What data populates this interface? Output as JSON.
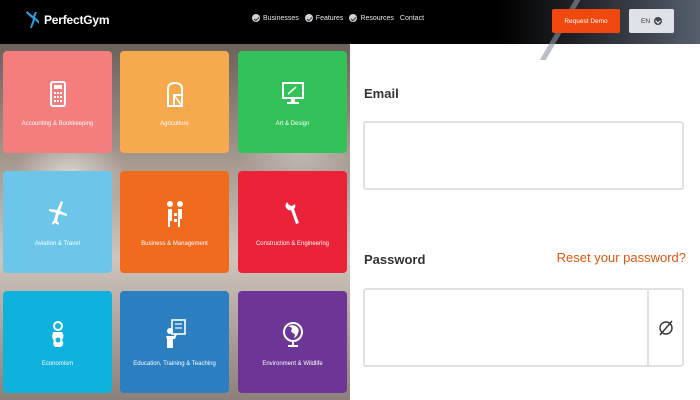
{
  "header": {
    "brand": "PerfectGym",
    "nav": [
      {
        "label": "Businesses",
        "icon": "chevron-down-icon"
      },
      {
        "label": "Features",
        "icon": "chevron-down-icon"
      },
      {
        "label": "Resources",
        "icon": "chevron-down-icon"
      },
      {
        "label": "Contact"
      }
    ],
    "demo_label": "Request Demo",
    "lang_label": "EN",
    "colors": {
      "demo": "#f0480f",
      "bar": "#000000"
    }
  },
  "tiles": [
    {
      "label": "Accounting & Bookkeeping",
      "icon": "calculator-icon",
      "color": "#f47d7d"
    },
    {
      "label": "Agriculture",
      "icon": "barn-icon",
      "color": "#f7a94e"
    },
    {
      "label": "Art & Design",
      "icon": "monitor-icon",
      "color": "#33c25a"
    },
    {
      "label": "Aviation & Travel",
      "icon": "airplane-icon",
      "color": "#6cc6ea"
    },
    {
      "label": "Business & Management",
      "icon": "people-icon",
      "color": "#f06b1e"
    },
    {
      "label": "Construction & Engineering",
      "icon": "wrench-icon",
      "color": "#ec2338"
    },
    {
      "label": "Economism",
      "icon": "money-icon",
      "color": "#0fb1dd"
    },
    {
      "label": "Education, Training & Teaching",
      "icon": "teacher-icon",
      "color": "#2b7ec0"
    },
    {
      "label": "Environment & Wildlife",
      "icon": "globe-icon",
      "color": "#6d3596"
    }
  ],
  "login": {
    "email_label": "Email",
    "email_value": "",
    "password_label": "Password",
    "password_value": "",
    "reset_label": "Reset your password?",
    "reset_color": "#e0570f"
  }
}
